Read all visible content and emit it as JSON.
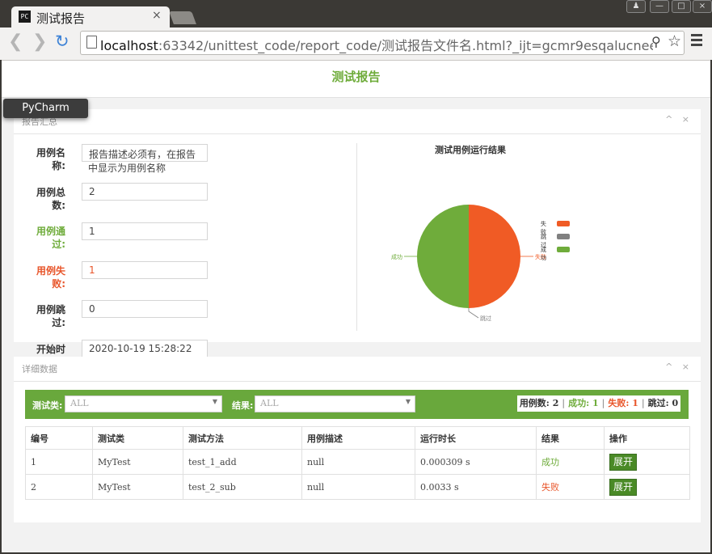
{
  "browser": {
    "tab_title": "测试报告",
    "tab_favicon": "PC",
    "close_glyph": "×",
    "url_host": "localhost",
    "url_rest": ":63342/unittest_code/report_code/测试报告文件名.html?_ijt=gcmr9esqalucneepnsurpf",
    "window_controls": {
      "user": "♟",
      "minimize": "—",
      "maximize": "□",
      "close": "×"
    },
    "icons": [
      "back-icon",
      "forward-icon",
      "reload-icon",
      "page-icon",
      "zoom-icon",
      "star-icon",
      "menu-icon"
    ]
  },
  "tooltip": {
    "text": "PyCharm"
  },
  "report": {
    "title": "测试报告"
  },
  "summary_panel": {
    "title": "报告汇总",
    "controls": "^ ×",
    "fields": [
      {
        "label": "用例名称:",
        "value": "报告描述必须有，在报告中显示为用例名称",
        "value_line1": "报告描述必须有，在报告",
        "value_line2": "中显示为用例名称",
        "color": "#333333"
      },
      {
        "label": "用例总数:",
        "value": "2",
        "color": "#333333"
      },
      {
        "label": "用例通过:",
        "value": "1",
        "color": "#6fac3b"
      },
      {
        "label": "用例失败:",
        "value": "1",
        "color": "#e8552a"
      },
      {
        "label": "用例跳过:",
        "value": "0",
        "color": "#333333"
      },
      {
        "label": "开始时间:",
        "value": "2020-10-19 15:28:22",
        "color": "#333333"
      }
    ]
  },
  "chart_data": {
    "type": "pie",
    "title": "测试用例运行结果",
    "slices": [
      {
        "label": "失败",
        "value": 1,
        "color": "#f05b25"
      },
      {
        "label": "跳过",
        "value": 0,
        "color": "#808080"
      },
      {
        "label": "成功",
        "value": 1,
        "color": "#6fac3b"
      }
    ],
    "legend": {
      "placement": "top-right",
      "items": [
        "失败",
        "跳过",
        "成功"
      ]
    }
  },
  "detail_panel": {
    "title": "详细数据",
    "controls": "^ ×",
    "filter": {
      "class_label": "测试类:",
      "class_value": "ALL",
      "result_label": "结果:",
      "result_value": "ALL"
    },
    "stats": {
      "total_label": "用例数:",
      "total": "2",
      "pass_label": "成功:",
      "pass": "1",
      "fail_label": "失败:",
      "fail": "1",
      "skip_label": "跳过:",
      "skip": "0",
      "sep": "|"
    },
    "columns": [
      "编号",
      "测试类",
      "测试方法",
      "用例描述",
      "运行时长",
      "结果",
      "操作"
    ],
    "rows": [
      {
        "id": "1",
        "cls": "MyTest",
        "method": "test_1_add",
        "desc": "null",
        "duration": "0.000309 s",
        "result": "成功",
        "result_color": "#6fac3b",
        "action": "展开"
      },
      {
        "id": "2",
        "cls": "MyTest",
        "method": "test_2_sub",
        "desc": "null",
        "duration": "0.0033 s",
        "result": "失败",
        "result_color": "#e8552a",
        "action": "展开"
      }
    ]
  }
}
